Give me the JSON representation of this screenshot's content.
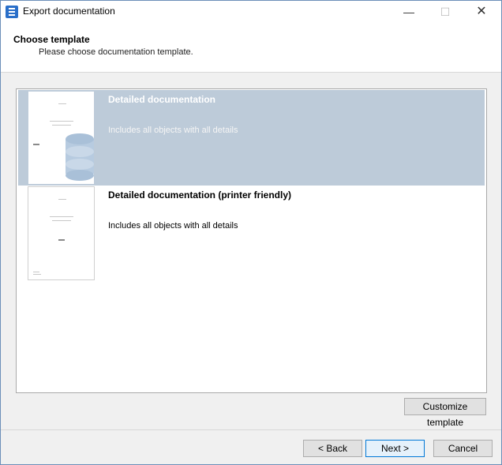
{
  "window": {
    "title": "Export documentation"
  },
  "header": {
    "title": "Choose template",
    "subtitle": "Please choose documentation template."
  },
  "templates": [
    {
      "name": "Detailed documentation",
      "description": "Includes all objects with all details",
      "selected": true
    },
    {
      "name": "Detailed documentation (printer friendly)",
      "description": "Includes all objects with all details",
      "selected": false
    }
  ],
  "buttons": {
    "customize": "Customize template",
    "back": "< Back",
    "next": "Next >",
    "cancel": "Cancel"
  },
  "colors": {
    "selection": "#bdcbd9",
    "accent": "#0078d7"
  }
}
